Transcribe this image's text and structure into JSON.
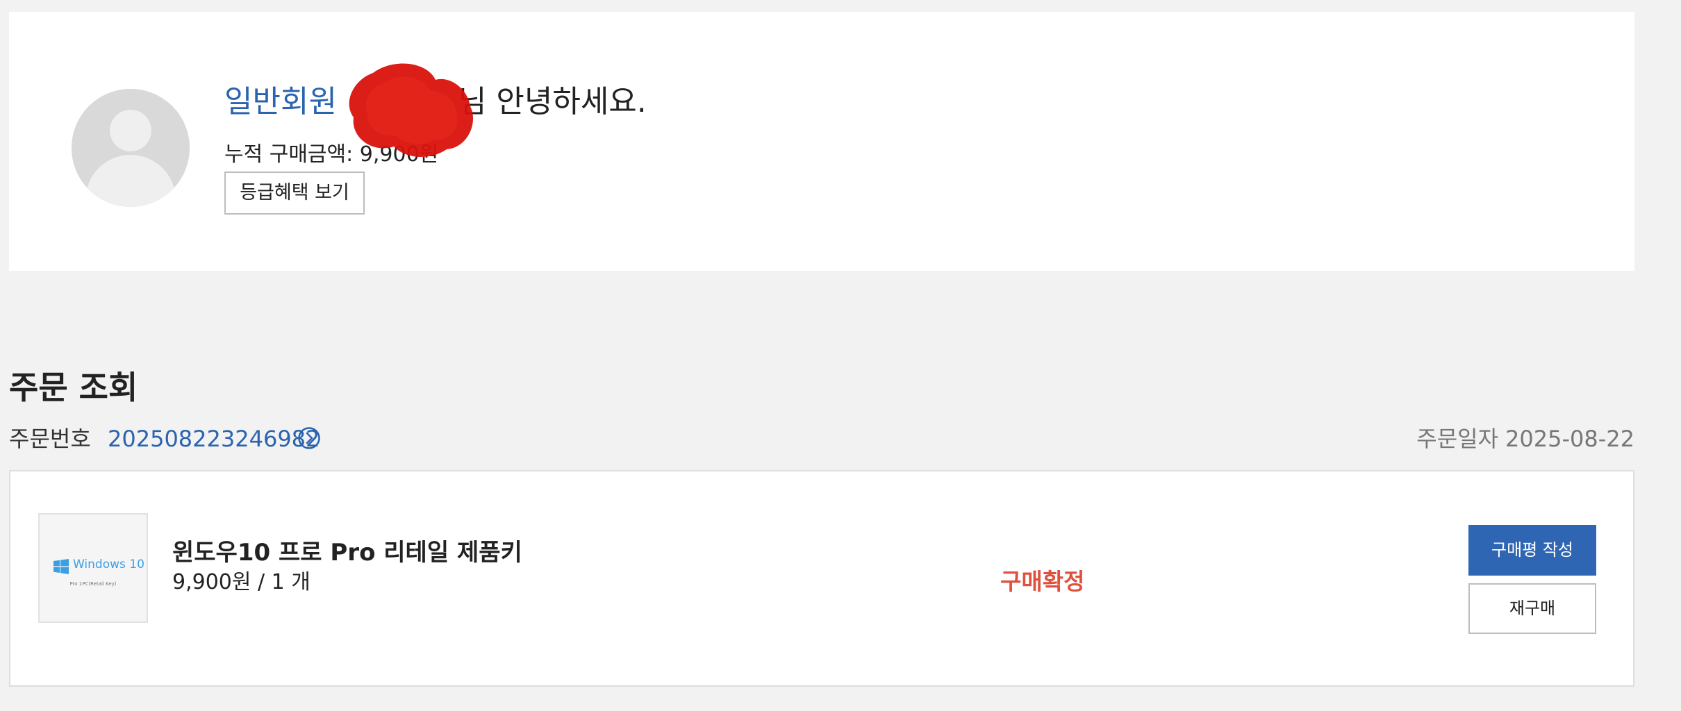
{
  "profile": {
    "grade": "일반회원",
    "greeting_suffix": "님 안녕하세요.",
    "total_spent_label": "누적 구매금액:",
    "total_spent_value": "9,900원",
    "benefit_button": "등급혜택 보기"
  },
  "orders": {
    "title": "주문 조회",
    "order_no_label": "주문번호",
    "order_no": "202508223246982",
    "order_date_label": "주문일자",
    "order_date": "2025-08-22",
    "item": {
      "thumb_brand": "Windows 10",
      "thumb_sub": "Pro 1PC(Retail Key)",
      "name": "윈도우10 프로 Pro 리테일 제품키",
      "price_qty": "9,900원 / 1 개",
      "status": "구매확정",
      "review_button": "구매평 작성",
      "rebuy_button": "재구매"
    }
  },
  "colors": {
    "link_blue": "#2a64b0",
    "button_blue": "#2e66b3",
    "status_red": "#e0503c",
    "redaction_red": "#d9120b"
  },
  "icons": {
    "avatar": "user-silhouette",
    "order_link": "chevron-right-circle-icon",
    "product": "windows-logo-icon"
  }
}
